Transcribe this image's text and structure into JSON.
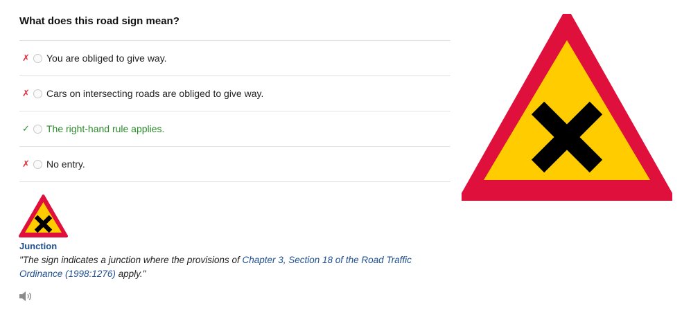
{
  "question": "What does this road sign mean?",
  "answers": [
    {
      "mark": "✗",
      "text": "You are obliged to give way."
    },
    {
      "mark": "✗",
      "text": "Cars on intersecting roads are obliged to give way."
    },
    {
      "mark": "✓",
      "text": "The right-hand rule applies."
    },
    {
      "mark": "✗",
      "text": "No entry."
    }
  ],
  "explanation": {
    "title": "Junction",
    "quote_open": "\"The sign indicates a junction where the provisions of ",
    "link_text": "Chapter 3, Section 18 of the Road Traffic Ordinance (1998:1276)",
    "quote_close": " apply.\""
  },
  "colors": {
    "sign_red": "#e0103c",
    "sign_yellow": "#ffcc00",
    "wrong": "#e0303c",
    "correct": "#2a8a2a",
    "link": "#1f4f8f"
  },
  "icons": {
    "sign": "junction-warning-sign",
    "speaker": "speaker-icon"
  }
}
